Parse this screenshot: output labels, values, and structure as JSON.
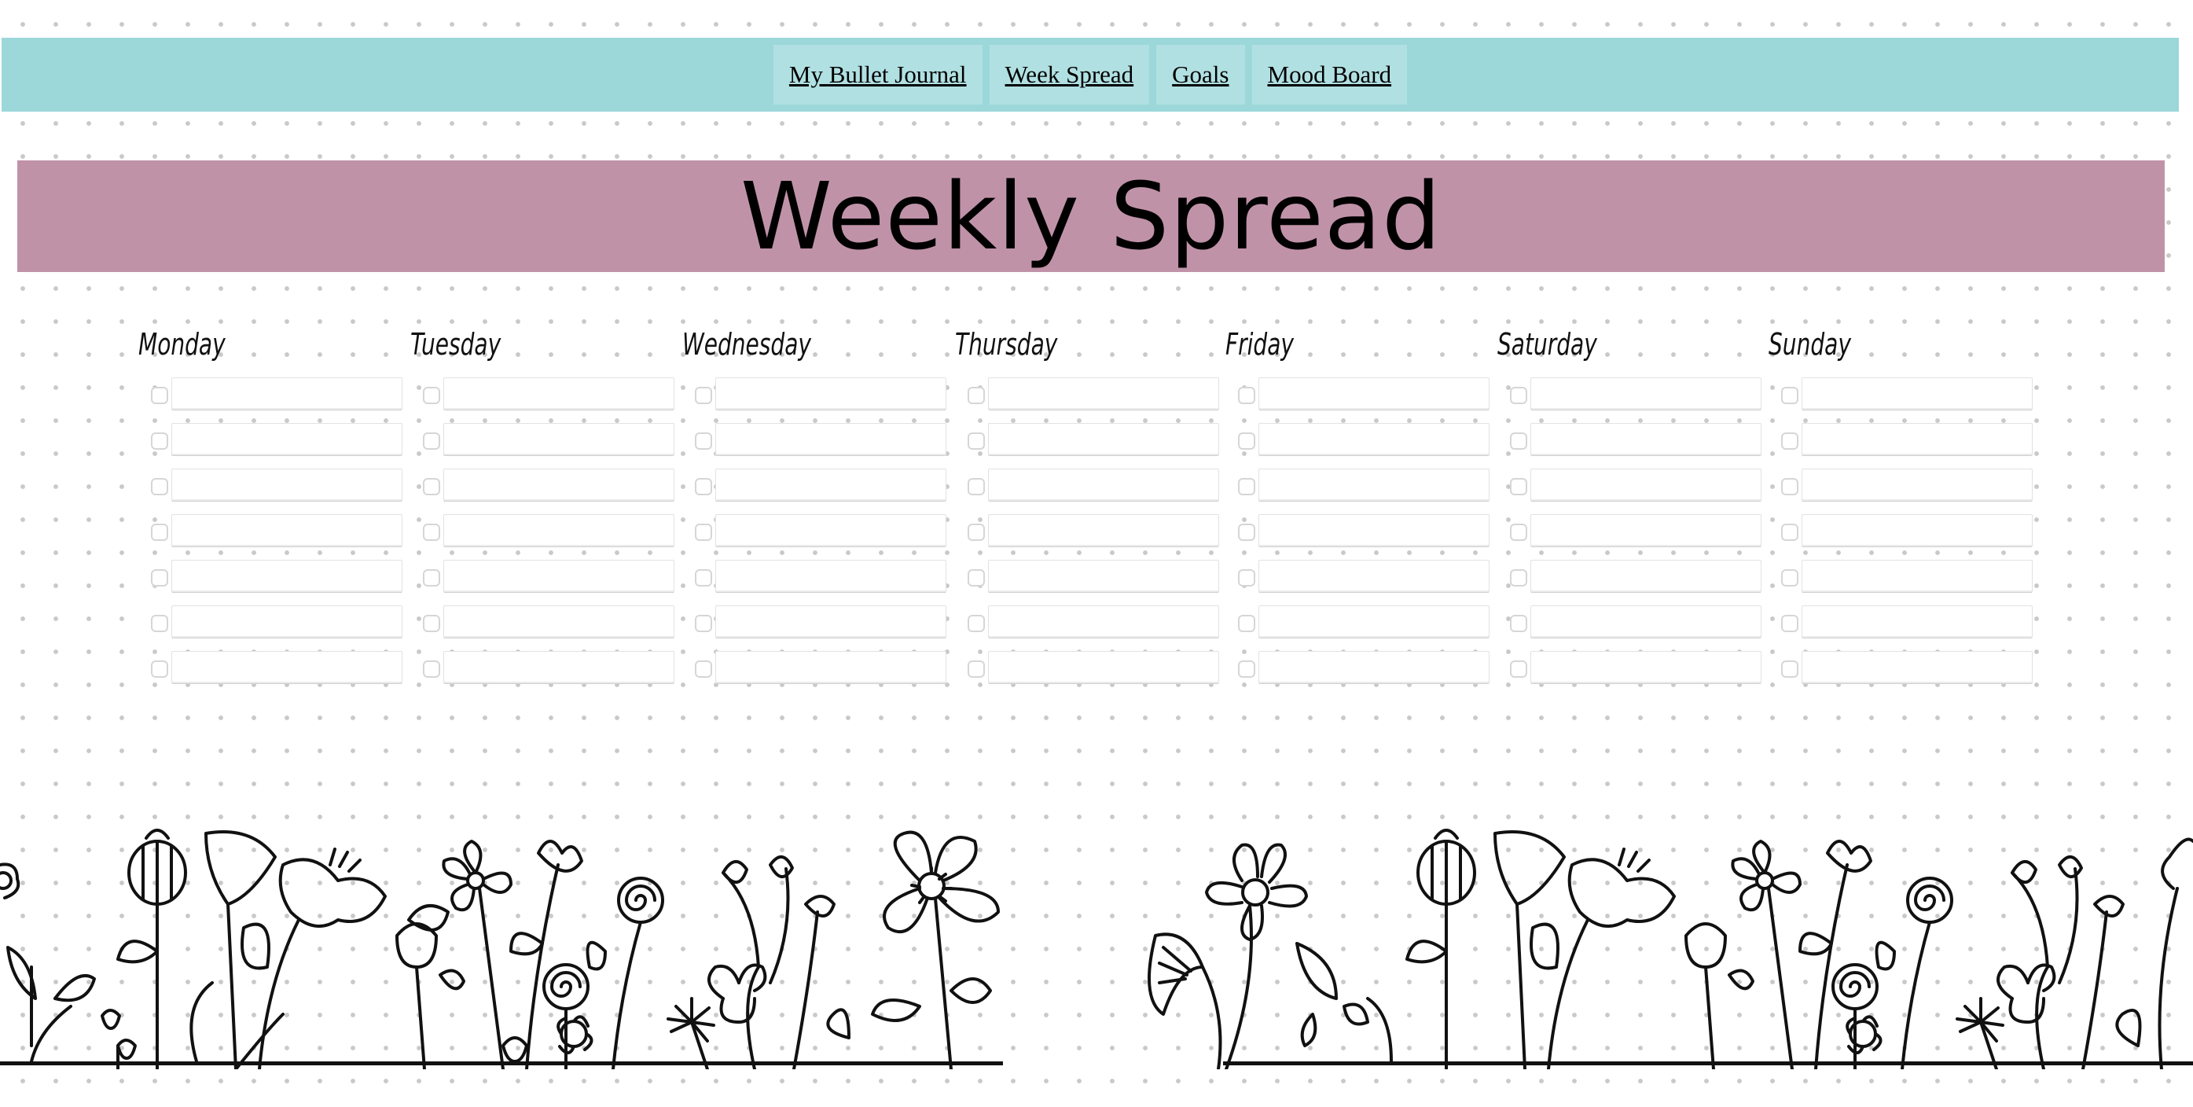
{
  "nav": {
    "links": [
      {
        "label": "My Bullet Journal"
      },
      {
        "label": "Week Spread"
      },
      {
        "label": "Goals"
      },
      {
        "label": "Mood Board"
      }
    ]
  },
  "header": {
    "title": "Weekly Spread"
  },
  "week": {
    "days": [
      {
        "name": "Monday",
        "tasks": [
          "",
          "",
          "",
          "",
          "",
          "",
          ""
        ]
      },
      {
        "name": "Tuesday",
        "tasks": [
          "",
          "",
          "",
          "",
          "",
          "",
          ""
        ]
      },
      {
        "name": "Wednesday",
        "tasks": [
          "",
          "",
          "",
          "",
          "",
          "",
          ""
        ]
      },
      {
        "name": "Thursday",
        "tasks": [
          "",
          "",
          "",
          "",
          "",
          "",
          ""
        ]
      },
      {
        "name": "Friday",
        "tasks": [
          "",
          "",
          "",
          "",
          "",
          "",
          ""
        ]
      },
      {
        "name": "Saturday",
        "tasks": [
          "",
          "",
          "",
          "",
          "",
          "",
          ""
        ]
      },
      {
        "name": "Sunday",
        "tasks": [
          "",
          "",
          "",
          "",
          "",
          "",
          ""
        ]
      }
    ]
  },
  "colors": {
    "nav_background": "#9cd7da",
    "nav_link_background": "#b1e0e2",
    "title_banner": "#c092a8",
    "dot_grid": "#c9c9c9"
  },
  "decoration": {
    "footer_art": "floral-doodle-border"
  }
}
